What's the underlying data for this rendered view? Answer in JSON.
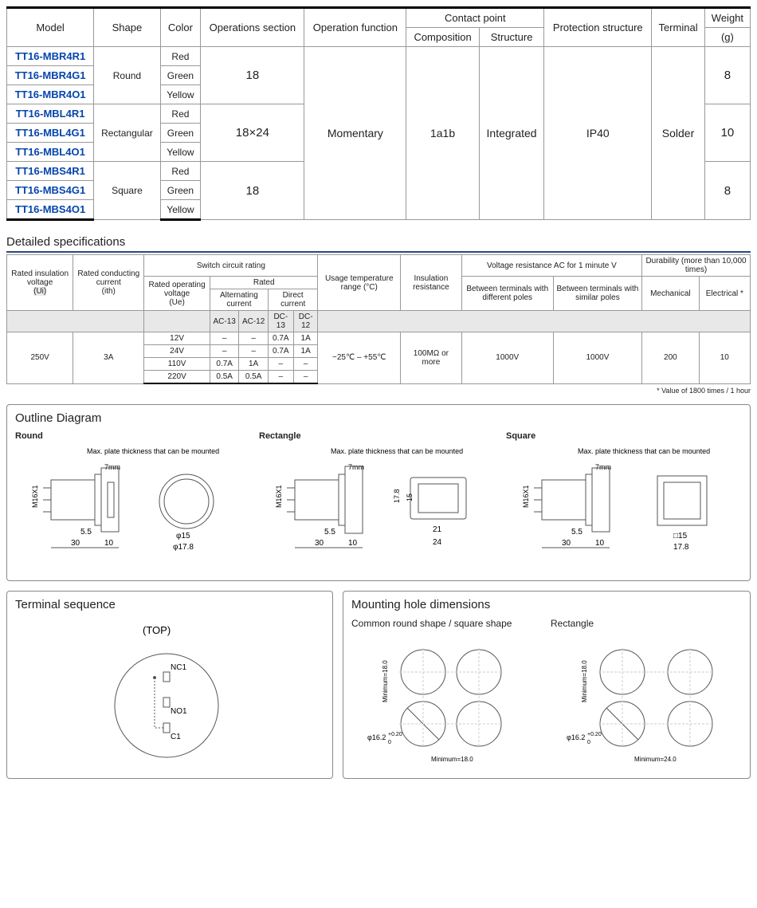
{
  "main_headers": {
    "model": "Model",
    "shape": "Shape",
    "color": "Color",
    "ops_section": "Operations section",
    "op_function": "Operation function",
    "contact_point": "Contact point",
    "composition": "Composition",
    "structure": "Structure",
    "protection": "Protection structure",
    "terminal": "Terminal",
    "weight": "Weight",
    "weight_unit": "(g)"
  },
  "main_rows": [
    {
      "model": "TT16-MBR4R1",
      "shape": "Round",
      "color": "Red",
      "ops": "18",
      "weight": "8"
    },
    {
      "model": "TT16-MBR4G1",
      "color": "Green"
    },
    {
      "model": "TT16-MBR4O1",
      "color": "Yellow"
    },
    {
      "model": "TT16-MBL4R1",
      "shape": "Rectangular",
      "color": "Red",
      "ops": "18×24",
      "weight": "10"
    },
    {
      "model": "TT16-MBL4G1",
      "color": "Green"
    },
    {
      "model": "TT16-MBL4O1",
      "color": "Yellow"
    },
    {
      "model": "TT16-MBS4R1",
      "shape": "Square",
      "color": "Red",
      "ops": "18",
      "weight": "8"
    },
    {
      "model": "TT16-MBS4G1",
      "color": "Green"
    },
    {
      "model": "TT16-MBS4O1",
      "color": "Yellow"
    }
  ],
  "main_common": {
    "op_function": "Momentary",
    "composition": "1a1b",
    "structure": "Integrated",
    "protection": "IP40",
    "terminal": "Solder"
  },
  "detailed_title": "Detailed specifications",
  "spec_headers": {
    "ui": "Rated insulation voltage",
    "ui_sub": "(Ui)",
    "ith": "Rated conducting current",
    "ith_sub": "(ith)",
    "switch_rating": "Switch circuit rating",
    "ue": "Rated operating voltage",
    "ue_sub": "(Ue)",
    "rated": "Rated",
    "ac": "Alternating current",
    "dc": "Direct current",
    "ac13": "AC-13",
    "ac12": "AC-12",
    "dc13": "DC-13",
    "dc12": "DC-12",
    "temp": "Usage temperature range (°C)",
    "insul": "Insulation resistance",
    "volt_res": "Voltage resistance AC for 1 minute V",
    "diff_poles": "Between terminals with different poles",
    "sim_poles": "Between terminals with similar poles",
    "durability": "Durability (more than 10,000 times)",
    "mech": "Mechanical",
    "elec": "Electrical *"
  },
  "spec_rows": [
    {
      "ue": "12V",
      "ac13": "–",
      "ac12": "–",
      "dc13": "0.7A",
      "dc12": "1A"
    },
    {
      "ue": "24V",
      "ac13": "–",
      "ac12": "–",
      "dc13": "0.7A",
      "dc12": "1A"
    },
    {
      "ue": "110V",
      "ac13": "0.7A",
      "ac12": "1A",
      "dc13": "–",
      "dc12": "–"
    },
    {
      "ue": "220V",
      "ac13": "0.5A",
      "ac12": "0.5A",
      "dc13": "–",
      "dc12": "–"
    }
  ],
  "spec_common": {
    "ui": "250V",
    "ith": "3A",
    "temp": "−25℃ – +55℃",
    "insul": "100MΩ or more",
    "diff": "1000V",
    "sim": "1000V",
    "mech": "200",
    "elec": "10"
  },
  "footnote": "* Value of 1800 times / 1 hour",
  "outline": {
    "title": "Outline Diagram",
    "round": "Round",
    "rect": "Rectangle",
    "square": "Square",
    "max_plate": "Max. plate thickness that can be mounted",
    "max_plate_val": "7mm",
    "thread": "M16X1",
    "l30": "30",
    "l10": "10",
    "l5_5": "5.5",
    "phi15": "φ15",
    "phi17_8": "φ17.8",
    "sq15": "□15",
    "d17_8": "17.8",
    "r21": "21",
    "r24": "24",
    "r15": "15",
    "r17_8": "17.8"
  },
  "terminal": {
    "title": "Terminal sequence",
    "top": "(TOP)",
    "nc1": "NC1",
    "no1": "NO1",
    "c1": "C1"
  },
  "mounting": {
    "title": "Mounting hole dimensions",
    "common": "Common round shape / square shape",
    "rect": "Rectangle",
    "phi": "φ16.2",
    "tol": "+0.20",
    "tol0": "0",
    "min18": "Minimum=18.0",
    "min24": "Minimum=24.0"
  }
}
